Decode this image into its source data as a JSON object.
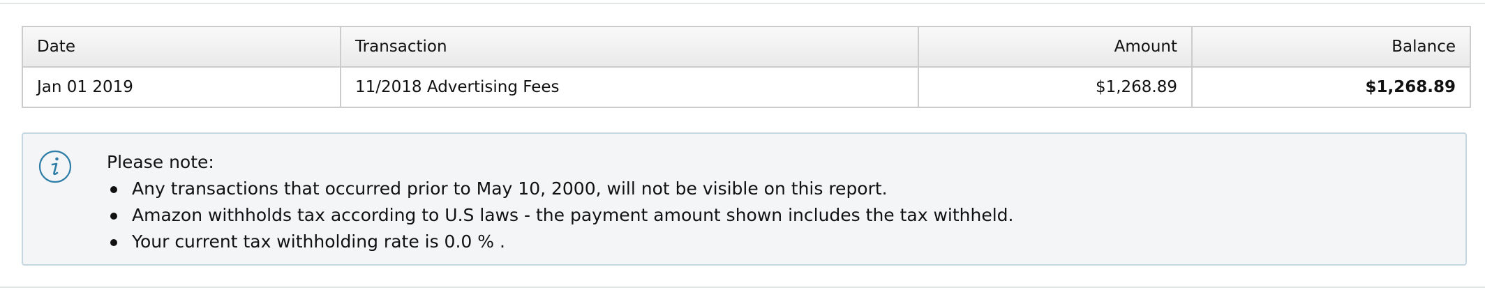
{
  "table": {
    "headers": {
      "date": "Date",
      "transaction": "Transaction",
      "amount": "Amount",
      "balance": "Balance"
    },
    "rows": [
      {
        "date": "Jan 01 2019",
        "transaction": "11/2018 Advertising Fees",
        "amount": "$1,268.89",
        "balance": "$1,268.89"
      }
    ]
  },
  "note": {
    "icon": "info-icon",
    "title": "Please note:",
    "items": [
      "Any transactions that occurred prior to May 10, 2000, will not be visible on this report.",
      "Amazon withholds tax according to U.S laws - the payment amount shown includes the tax withheld.",
      "Your current tax withholding rate is 0.0 % ."
    ]
  },
  "colors": {
    "border": "#cccccc",
    "note_background": "#f3f5f6",
    "note_border": "#c5d7e0",
    "info_icon": "#2e7ea8"
  }
}
